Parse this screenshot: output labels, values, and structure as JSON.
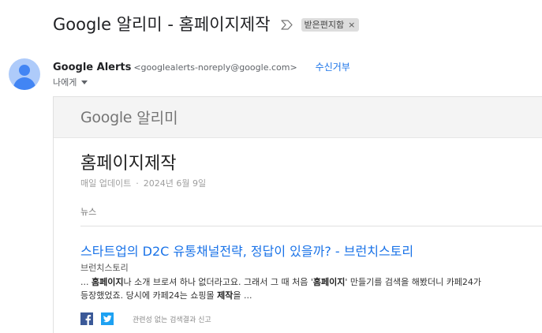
{
  "subject": {
    "title": "Google 알리미 - 홈페이지제작",
    "label": "받은편지함",
    "label_close": "×"
  },
  "sender": {
    "name": "Google Alerts",
    "email": "<googlealerts-noreply@google.com>",
    "unsubscribe": "수신거부",
    "to": "나에게"
  },
  "card": {
    "brand_word": "Google",
    "brand_suffix": "알리미",
    "alert_title": "홈페이지제작",
    "frequency": "매일 업데이트",
    "separator": "·",
    "date": "2024년 6월 9일",
    "section": "뉴스"
  },
  "result": {
    "title": "스타트업의 D2C 유통채널전략, 정답이 있을까? - 브런치스토리",
    "source": "브런치스토리",
    "snippet": {
      "p1": "... ",
      "b1": "홈페이지",
      "p2": "나 소개 브로셔 하나 없더라고요. 그래서 그 때 처음 '",
      "b2": "홈페이지",
      "p3": "' 만들기를 검색을 해봤더니 카페24가",
      "p4": "등장했었죠. 당시에 카페24는 쇼핑몰 ",
      "b3": "제작",
      "p5": "을 ..."
    },
    "report": "관련성 없는 검색결과 신고"
  },
  "colors": {
    "link": "#1a73e8",
    "facebook": "#3b5998",
    "twitter": "#1da1f2",
    "avatar": "#4285f4"
  },
  "icons": [
    "important-icon",
    "facebook-icon",
    "twitter-icon",
    "caret-down-icon",
    "avatar"
  ]
}
